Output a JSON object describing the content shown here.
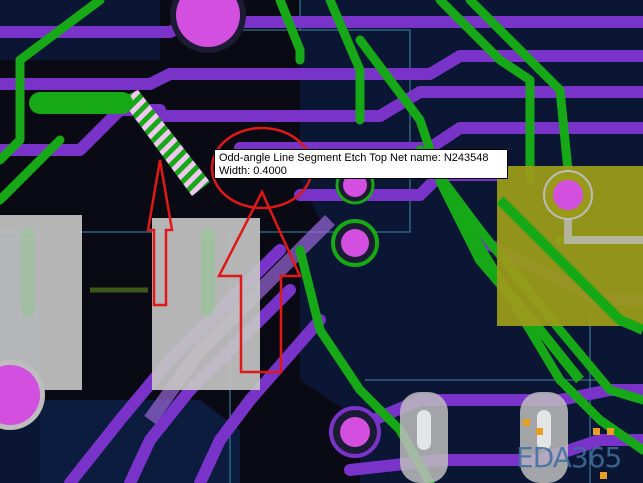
{
  "tooltip": {
    "line1": "Odd-angle Line Segment   Etch   Top   Net name: N243548",
    "line2": "Width: 0.4000"
  },
  "watermark": "EDA365",
  "colors": {
    "background": "#0b1634",
    "purple_trace": "#7a33c8",
    "green_trace": "#16a816",
    "pad_gray": "#bdbdbd",
    "via_magenta": "#d24fe0",
    "annotation_red": "#e01818",
    "highlight_stripe": "#f2c8f2",
    "olive_pad": "#9a9a1a"
  },
  "icons": {
    "annotation_arrow": "up-arrow-outline",
    "annotation_circle": "ellipse-outline"
  }
}
